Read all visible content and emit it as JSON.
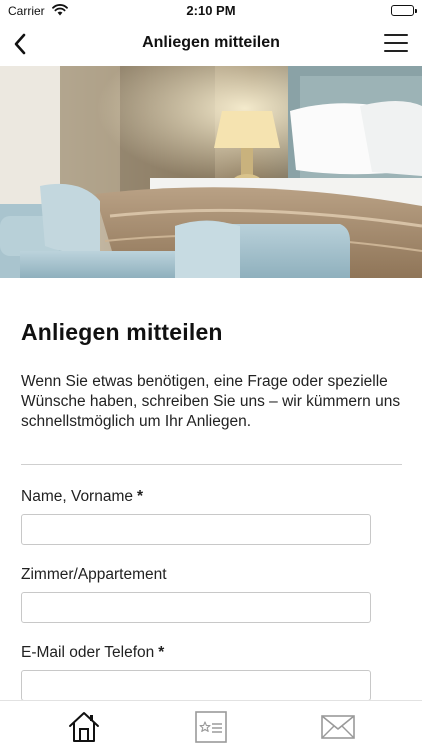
{
  "status_bar": {
    "carrier": "Carrier",
    "time": "2:10 PM"
  },
  "nav": {
    "title": "Anliegen mitteilen"
  },
  "hero": {
    "subject": "hotel-bedroom-photo"
  },
  "form": {
    "heading": "Anliegen mitteilen",
    "intro": "Wenn Sie etwas benötigen, eine Frage oder spezielle Wünsche haben, schreiben Sie uns – wir kümmern uns schnellstmöglich um Ihr Anliegen.",
    "fields": [
      {
        "label": "Name, Vorname",
        "required_mark": "*",
        "value": ""
      },
      {
        "label": "Zimmer/Appartement",
        "value": ""
      },
      {
        "label": "E-Mail oder Telefon",
        "required_mark": "*",
        "value": ""
      }
    ]
  },
  "tabs": [
    {
      "icon": "home-icon"
    },
    {
      "icon": "star-list-icon"
    },
    {
      "icon": "envelope-icon"
    }
  ]
}
